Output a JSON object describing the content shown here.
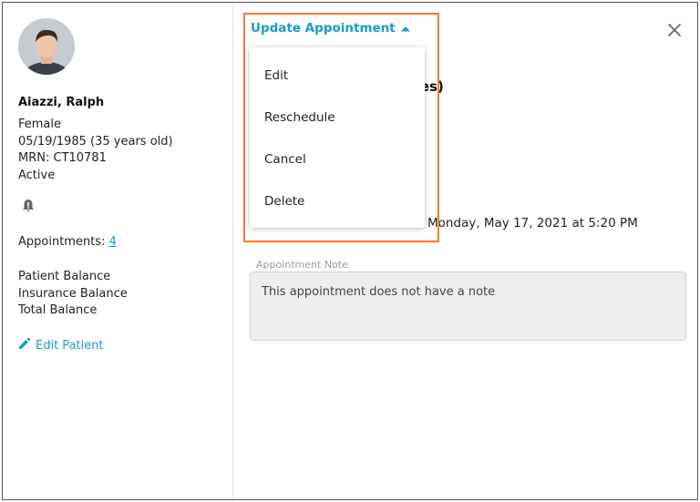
{
  "patient": {
    "name": "Aiazzi, Ralph",
    "gender": "Female",
    "dob": "05/19/1985 (35 years old)",
    "mrn": "MRN: CT10781",
    "status": "Active",
    "appointments_label": "Appointments:",
    "appointments_count": "4",
    "balances": [
      "Patient Balance",
      "Insurance Balance",
      "Total Balance"
    ],
    "edit_label": "Edit Patient"
  },
  "header": {
    "update_label": "Update Appointment",
    "partial_title": "utes)",
    "close_icon": "close-icon"
  },
  "menu": {
    "items": [
      "Edit",
      "Reschedule",
      "Cancel",
      "Delete"
    ]
  },
  "appointment": {
    "date_text": "Monday, May 17, 2021 at 5:20 PM",
    "note_label": "Appointment Note",
    "note_text": "This appointment does not have a note"
  },
  "colors": {
    "accent": "#1a9cc7",
    "highlight": "#f07a2a"
  }
}
